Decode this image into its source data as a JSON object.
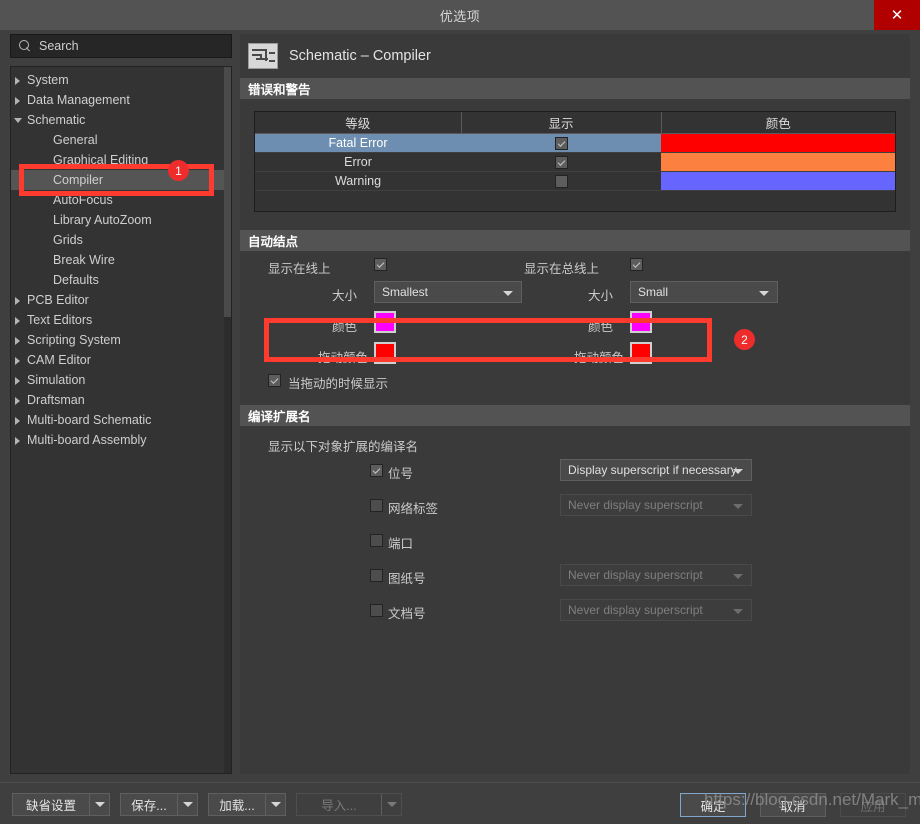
{
  "window": {
    "title": "优选项",
    "close_label": "✕"
  },
  "search": {
    "placeholder": "Search",
    "value": "Search",
    "icon": "search-icon"
  },
  "sidebar": {
    "items": [
      {
        "label": "System",
        "level": 0,
        "twisty": "collapsed",
        "selected": false
      },
      {
        "label": "Data Management",
        "level": 0,
        "twisty": "collapsed",
        "selected": false
      },
      {
        "label": "Schematic",
        "level": 0,
        "twisty": "expanded",
        "selected": false
      },
      {
        "label": "General",
        "level": 1,
        "twisty": "none",
        "selected": false
      },
      {
        "label": "Graphical Editing",
        "level": 1,
        "twisty": "none",
        "selected": false
      },
      {
        "label": "Compiler",
        "level": 1,
        "twisty": "none",
        "selected": true
      },
      {
        "label": "AutoFocus",
        "level": 1,
        "twisty": "none",
        "selected": false
      },
      {
        "label": "Library AutoZoom",
        "level": 1,
        "twisty": "none",
        "selected": false
      },
      {
        "label": "Grids",
        "level": 1,
        "twisty": "none",
        "selected": false
      },
      {
        "label": "Break Wire",
        "level": 1,
        "twisty": "none",
        "selected": false
      },
      {
        "label": "Defaults",
        "level": 1,
        "twisty": "none",
        "selected": false
      },
      {
        "label": "PCB Editor",
        "level": 0,
        "twisty": "collapsed",
        "selected": false
      },
      {
        "label": "Text Editors",
        "level": 0,
        "twisty": "collapsed",
        "selected": false
      },
      {
        "label": "Scripting System",
        "level": 0,
        "twisty": "collapsed",
        "selected": false
      },
      {
        "label": "CAM Editor",
        "level": 0,
        "twisty": "collapsed",
        "selected": false
      },
      {
        "label": "Simulation",
        "level": 0,
        "twisty": "collapsed",
        "selected": false
      },
      {
        "label": "Draftsman",
        "level": 0,
        "twisty": "collapsed",
        "selected": false
      },
      {
        "label": "Multi-board Schematic",
        "level": 0,
        "twisty": "collapsed",
        "selected": false
      },
      {
        "label": "Multi-board Assembly",
        "level": 0,
        "twisty": "collapsed",
        "selected": false
      }
    ]
  },
  "page": {
    "title": "Schematic – Compiler",
    "icon": "schematic-document-icon"
  },
  "errors_section": {
    "header": "错误和警告",
    "columns": [
      "等级",
      "显示",
      "颜色"
    ],
    "rows": [
      {
        "level": "Fatal Error",
        "show": true,
        "color": "#ff0000",
        "selected": true
      },
      {
        "level": "Error",
        "show": true,
        "color": "#fc8040",
        "selected": false
      },
      {
        "level": "Warning",
        "show": false,
        "color": "#6666ff",
        "selected": false
      }
    ]
  },
  "junctions_section": {
    "header": "自动结点",
    "left": {
      "display_label": "显示在线上",
      "display_checked": true,
      "size_label": "大小",
      "size_value": "Smallest",
      "color_label": "颜色",
      "color_value": "#ff00ff",
      "drag_color_label": "拖动颜色",
      "drag_color_value": "#ff0000"
    },
    "right": {
      "display_label": "显示在总线上",
      "display_checked": true,
      "size_label": "大小",
      "size_value": "Small",
      "color_label": "颜色",
      "color_value": "#ff00ff",
      "drag_color_label": "拖动颜色",
      "drag_color_value": "#ff0000"
    },
    "show_while_dragging_label": "当拖动的时候显示",
    "show_while_dragging_checked": true
  },
  "compile_section": {
    "header": "编译扩展名",
    "intro": "显示以下对象扩展的编译名",
    "rows": [
      {
        "label": "位号",
        "checked": true,
        "select": "Display superscript if necessary",
        "select_disabled": false,
        "has_select": true
      },
      {
        "label": "网络标签",
        "checked": false,
        "select": "Never display superscript",
        "select_disabled": true,
        "has_select": true
      },
      {
        "label": "端口",
        "checked": false,
        "select": "",
        "select_disabled": true,
        "has_select": false
      },
      {
        "label": "图纸号",
        "checked": false,
        "select": "Never display superscript",
        "select_disabled": true,
        "has_select": true
      },
      {
        "label": "文档号",
        "checked": false,
        "select": "Never display superscript",
        "select_disabled": true,
        "has_select": true
      }
    ]
  },
  "footer": {
    "split_buttons": [
      {
        "label": "缺省设置",
        "disabled": false
      },
      {
        "label": "保存...",
        "disabled": false
      },
      {
        "label": "加载...",
        "disabled": false
      },
      {
        "label": "导入...",
        "disabled": true
      }
    ],
    "ok_label": "确定",
    "cancel_label": "取消",
    "apply_label": "应用"
  },
  "annotations": {
    "badge1": "1",
    "badge2": "2"
  },
  "watermark": "https://blog.csdn.net/Mark_md",
  "colors": {
    "accent_red": "#ff3b30",
    "selection_blue": "#6d8eb0",
    "titlebar": "#535353",
    "panel_bg": "#3a3a3a"
  }
}
